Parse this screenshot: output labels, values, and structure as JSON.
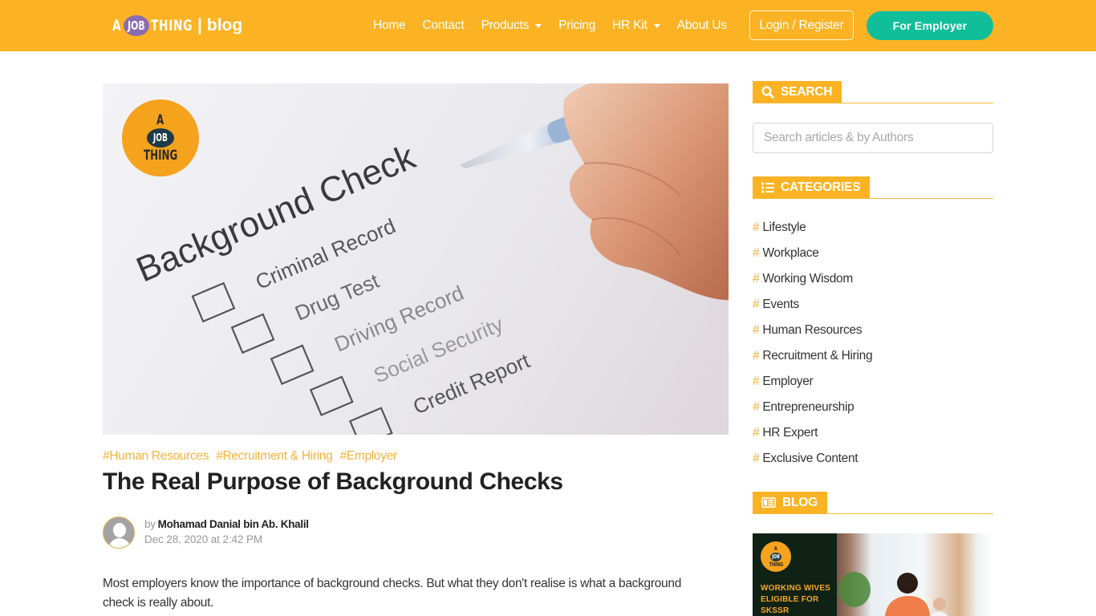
{
  "navbar": {
    "brand": {
      "a": "A",
      "job": "JOB",
      "thing": "THING",
      "separator": "|",
      "section": "blog"
    },
    "items": [
      {
        "label": "Home",
        "dropdown": false
      },
      {
        "label": "Contact",
        "dropdown": false
      },
      {
        "label": "Products",
        "dropdown": true
      },
      {
        "label": "Pricing",
        "dropdown": false
      },
      {
        "label": "HR Kit",
        "dropdown": true
      },
      {
        "label": "About Us",
        "dropdown": false
      }
    ],
    "login_label": "Login / Register",
    "employer_label": "For Employer"
  },
  "hero": {
    "logo": {
      "a": "A",
      "job": "JOB",
      "thing": "THING"
    },
    "heading": "Background Check",
    "checklist": [
      "Criminal Record",
      "Drug Test",
      "Driving Record",
      "Social Security",
      "Credit Report"
    ]
  },
  "article": {
    "tags": [
      "#Human Resources",
      "#Recruitment & Hiring",
      "#Employer"
    ],
    "title": "The Real Purpose of Background Checks",
    "by": "by",
    "author": "Mohamad Danial bin Ab. Khalil",
    "date": "Dec 28, 2020 at 2:42 PM",
    "intro": "Most employers know the importance of background checks. But what they don't realise is what a background check is really about."
  },
  "sidebar": {
    "search": {
      "title": "SEARCH",
      "placeholder": "Search articles & by Authors",
      "value": ""
    },
    "categories": {
      "title": "CATEGORIES",
      "hash": "#",
      "items": [
        "Lifestyle",
        "Workplace",
        "Working Wisdom",
        "Events",
        "Human Resources",
        "Recruitment & Hiring",
        "Employer",
        "Entrepreneurship",
        "HR Expert",
        "Exclusive Content"
      ]
    },
    "blog": {
      "title": "BLOG",
      "card": {
        "logo": {
          "a": "A",
          "job": "JOB",
          "thing": "THING"
        },
        "caption_lines": [
          "WORKING WIVES",
          "ELIGIBLE FOR",
          "SKSSR"
        ]
      }
    }
  },
  "colors": {
    "brand_yellow": "#fbb323",
    "employer_green": "#10bf9a",
    "tag_orange": "#f5b23a",
    "brand_purple": "#8c6bb1"
  }
}
